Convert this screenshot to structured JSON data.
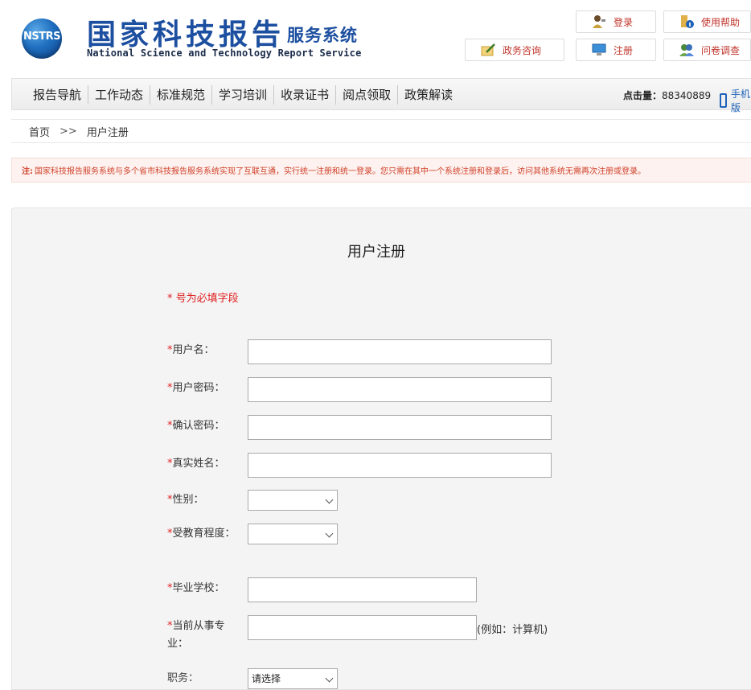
{
  "header": {
    "logo_text": "NSTRS",
    "title_cn": "国家科技报告",
    "title_cn_suffix": "服务系统",
    "title_en": "National Science and Technology Report Service",
    "buttons": {
      "consult": "政务咨询",
      "login": "登录",
      "register": "注册",
      "help": "使用帮助",
      "survey": "问卷调查"
    }
  },
  "nav": {
    "items": [
      "报告导航",
      "工作动态",
      "标准规范",
      "学习培训",
      "收录证书",
      "阅点领取",
      "政策解读"
    ],
    "hits_label": "点击量：",
    "hits_value": "88340889",
    "mobile_label": "手机版"
  },
  "breadcrumb": {
    "home": "首页",
    "sep": ">>",
    "current": "用户注册"
  },
  "notice": {
    "prefix": "注:",
    "text": "国家科技报告服务系统与多个省市科技报告服务系统实现了互联互通，实行统一注册和统一登录。您只需在其中一个系统注册和登录后，访问其他系统无需再次注册或登录。"
  },
  "form": {
    "title": "用户注册",
    "required_note": "* 号为必填字段",
    "star": "*",
    "fields": {
      "username": "用户名：",
      "password": "用户密码：",
      "confirm_password": "确认密码：",
      "real_name": "真实姓名：",
      "gender": "性别：",
      "education": "受教育程度：",
      "school": "毕业学校：",
      "major": "当前从事专业：",
      "position": "职务："
    },
    "major_hint": "(例如：计算机)",
    "position_select": "请选择",
    "gender_value": "",
    "education_value": ""
  },
  "colors": {
    "brand_blue": "#1d4fa0",
    "required_red": "#e02020",
    "notice_red": "#d0402a"
  }
}
